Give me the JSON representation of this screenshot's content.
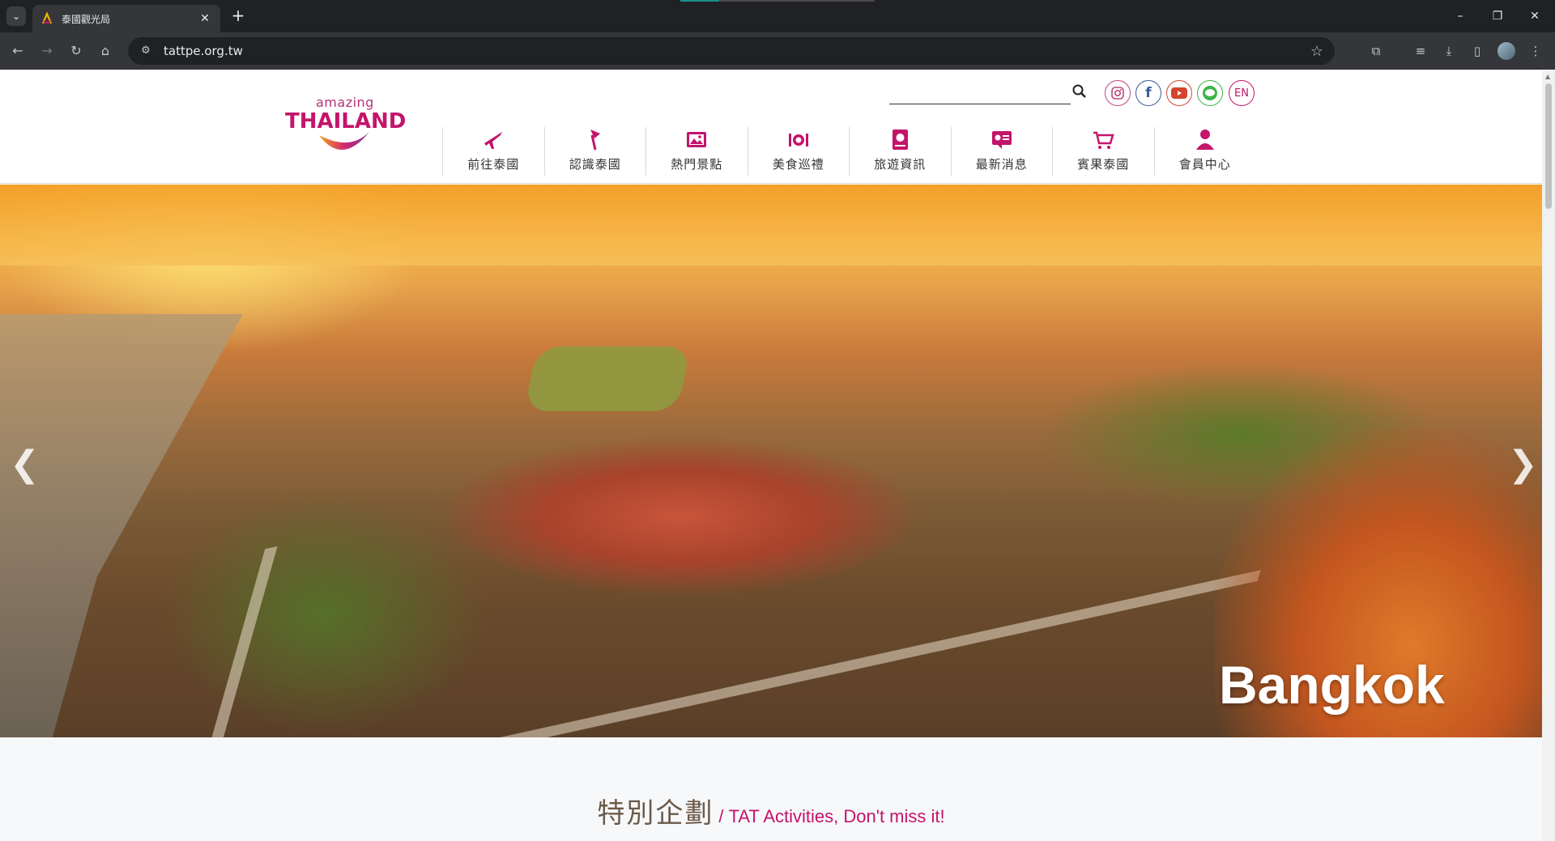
{
  "browser": {
    "tab_title": "泰國觀光局",
    "url": "tattpe.org.tw"
  },
  "header": {
    "logo": {
      "top": "amazing",
      "main": "THAILAND"
    },
    "search_placeholder": "",
    "social": {
      "en_label": "EN"
    },
    "nav": [
      {
        "label": "前往泰國",
        "icon": "plane-icon"
      },
      {
        "label": "認識泰國",
        "icon": "flag-icon"
      },
      {
        "label": "熱門景點",
        "icon": "photo-icon"
      },
      {
        "label": "美食巡禮",
        "icon": "dining-icon"
      },
      {
        "label": "旅遊資訊",
        "icon": "guidebook-icon"
      },
      {
        "label": "最新消息",
        "icon": "news-icon"
      },
      {
        "label": "賓果泰國",
        "icon": "shopping-cart-icon"
      },
      {
        "label": "會員中心",
        "icon": "member-icon"
      }
    ]
  },
  "hero": {
    "caption": "Bangkok",
    "prev": "❮",
    "next": "❯"
  },
  "section": {
    "title_zh": "特別企劃",
    "title_en": "/ TAT Activities, Don't miss it!"
  },
  "colors": {
    "brand": "#c4146b",
    "nav_text": "#333333"
  }
}
